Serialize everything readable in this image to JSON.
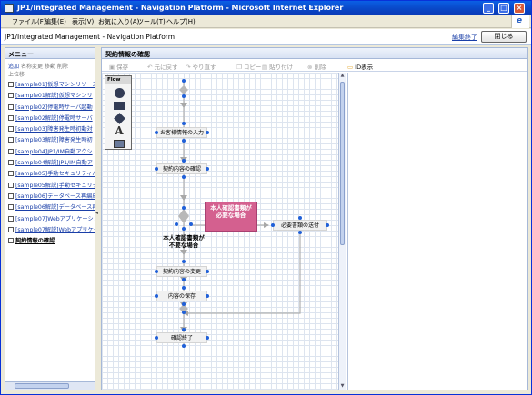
{
  "window": {
    "title": "JP1/Integrated Management - Navigation Platform - Microsoft Internet Explorer",
    "min_glyph": "_",
    "max_glyph": "□",
    "close_glyph": "×"
  },
  "menubar": {
    "items": [
      "ファイル(F)",
      "編集(E)",
      "表示(V)",
      "お気に入り(A)",
      "ツール(T)",
      "ヘルプ(H)"
    ]
  },
  "header": {
    "title": "JP1/Integrated Management - Navigation Platform",
    "edit_end": "編集終了",
    "close_label": "閉じる"
  },
  "sidebar": {
    "title": "メニュー",
    "actions": [
      "追加",
      "名称変更",
      "移動",
      "削除"
    ],
    "actions2": "上位移",
    "items": [
      {
        "label": "[sample01]仮想マシンリソース"
      },
      {
        "label": "[sample01解説]仮想マシンリ"
      },
      {
        "label": "[sample02]停電時サーバ起動"
      },
      {
        "label": "[sample02解説]停電時サーバ"
      },
      {
        "label": "[sample03]障害発生時初動対"
      },
      {
        "label": "[sample03解説]障害発生時初"
      },
      {
        "label": "[sample04]JP1/IM自動アクシ"
      },
      {
        "label": "[sample04解説]JP1/IM自動ア"
      },
      {
        "label": "[sample05]手動セキュリティパ"
      },
      {
        "label": "[sample05解説]手動セキュリテ"
      },
      {
        "label": "[sample06]データベース再編成"
      },
      {
        "label": "[sample06解説]データベース再"
      },
      {
        "label": "[sample07]Webアプリケーショ"
      },
      {
        "label": "[sample07解説]Webアプリケー"
      },
      {
        "label": "契約情報の確認"
      }
    ],
    "active_index": 14
  },
  "main": {
    "title": "契約情報の確認",
    "toolbar": [
      {
        "label": "保存",
        "icon": "save-icon",
        "glyph": "▣",
        "enabled": false
      },
      {
        "label": "元に戻す",
        "icon": "undo-icon",
        "glyph": "↶",
        "enabled": false
      },
      {
        "label": "やり直す",
        "icon": "redo-icon",
        "glyph": "↷",
        "enabled": false
      },
      {
        "label": "コピー",
        "icon": "copy-icon",
        "glyph": "❐",
        "enabled": false
      },
      {
        "label": "貼り付け",
        "icon": "paste-icon",
        "glyph": "▤",
        "enabled": false
      },
      {
        "label": "削除",
        "icon": "delete-icon",
        "glyph": "⊗",
        "enabled": false
      },
      {
        "label": "ID表示",
        "icon": "id-display-icon",
        "glyph": "▭",
        "enabled": true
      }
    ]
  },
  "palette": {
    "label": "Flow",
    "text_tool_glyph": "A",
    "tools": [
      "circle-tool-icon",
      "rectangle-tool-icon",
      "diamond-tool-icon",
      "text-tool-icon",
      "image-tool-icon"
    ]
  },
  "flow": {
    "nodes": [
      {
        "label": "お客様情報の入力"
      },
      {
        "label": "契約内容の確認"
      },
      {
        "label": "本人確認書類が\n必要な場合"
      },
      {
        "label": "必要書類の送付"
      },
      {
        "label": "契約内容の変更"
      },
      {
        "label": "内容の保存"
      },
      {
        "label": "確認終了"
      }
    ],
    "branch_label": "本人確認書類が\n不要な場合"
  }
}
